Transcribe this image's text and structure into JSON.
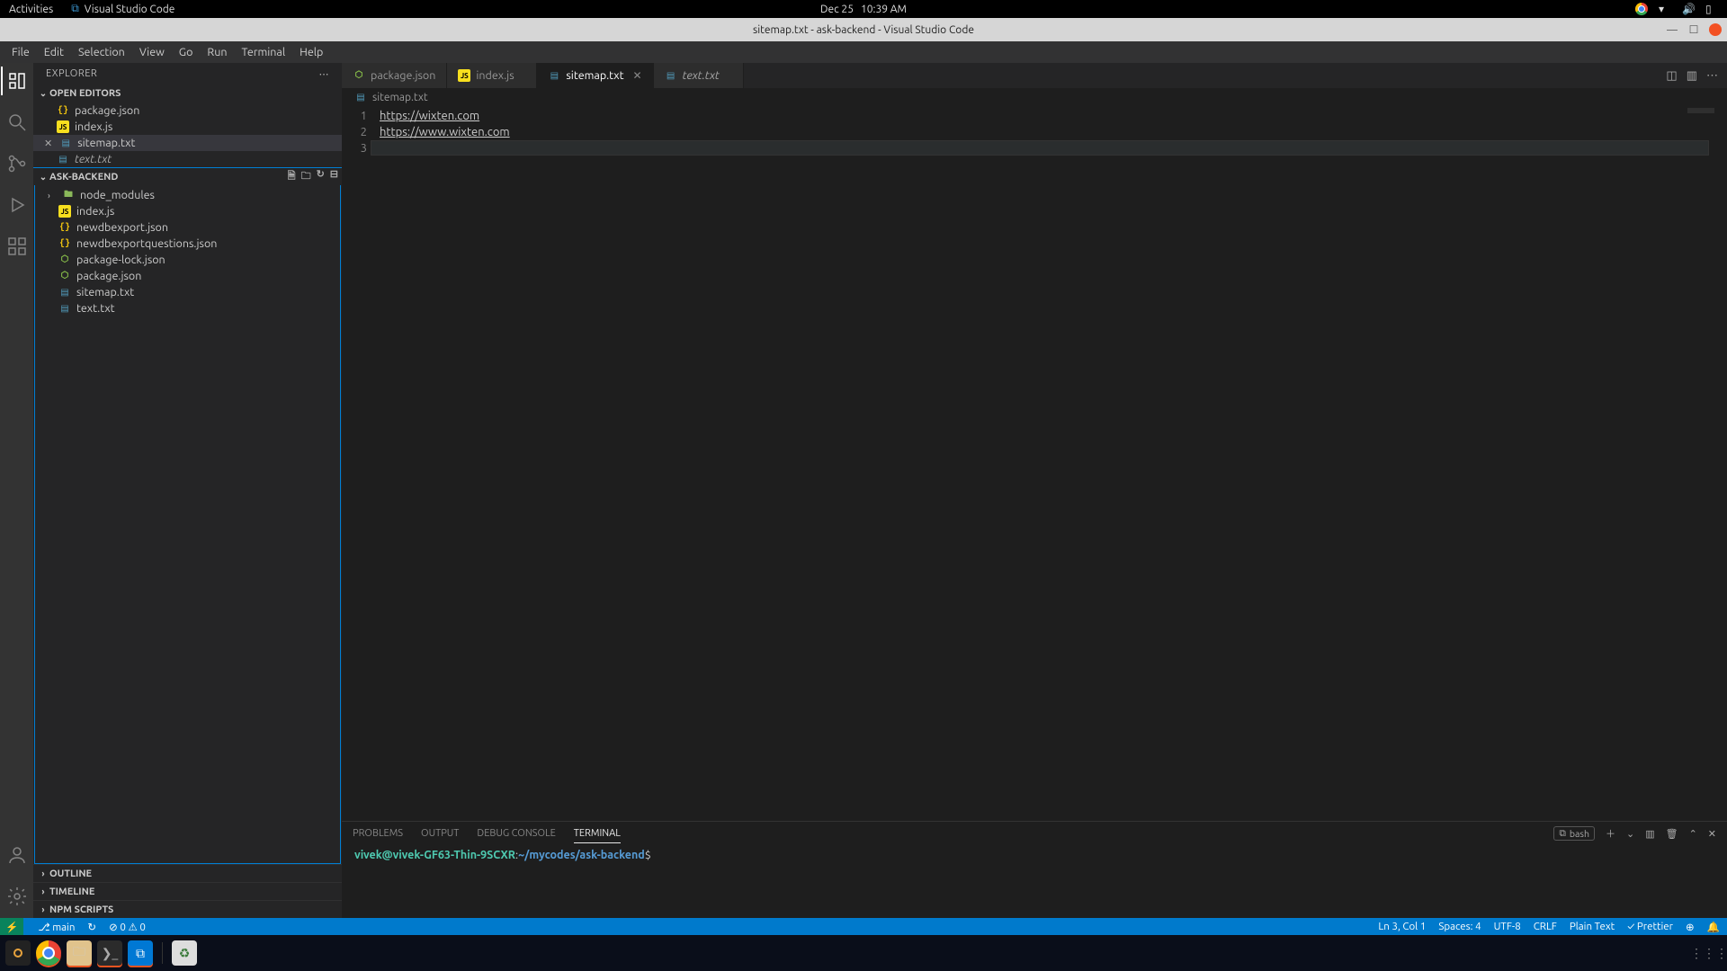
{
  "os": {
    "activities": "Activities",
    "app_label": "Visual Studio Code",
    "date": "Dec 25",
    "time": "10:39 AM"
  },
  "window": {
    "title": "sitemap.txt - ask-backend - Visual Studio Code"
  },
  "menu": [
    "File",
    "Edit",
    "Selection",
    "View",
    "Go",
    "Run",
    "Terminal",
    "Help"
  ],
  "sidebar": {
    "title": "EXPLORER",
    "open_editors_label": "OPEN EDITORS",
    "open_editors": [
      {
        "name": "package.json",
        "icon": "json"
      },
      {
        "name": "index.js",
        "icon": "js"
      },
      {
        "name": "sitemap.txt",
        "icon": "txt",
        "active": true
      },
      {
        "name": "text.txt",
        "icon": "txt",
        "italic": true
      }
    ],
    "project_label": "ASK-BACKEND",
    "tree": [
      {
        "name": "node_modules",
        "icon": "folder",
        "chev": true
      },
      {
        "name": "index.js",
        "icon": "js"
      },
      {
        "name": "newdbexport.json",
        "icon": "json"
      },
      {
        "name": "newdbexportquestions.json",
        "icon": "json"
      },
      {
        "name": "package-lock.json",
        "icon": "json-npm"
      },
      {
        "name": "package.json",
        "icon": "json-npm"
      },
      {
        "name": "sitemap.txt",
        "icon": "txt"
      },
      {
        "name": "text.txt",
        "icon": "txt"
      }
    ],
    "outline_label": "OUTLINE",
    "timeline_label": "TIMELINE",
    "npm_label": "NPM SCRIPTS"
  },
  "tabs": [
    {
      "label": "package.json",
      "icon": "json-npm"
    },
    {
      "label": "index.js",
      "icon": "js"
    },
    {
      "label": "sitemap.txt",
      "icon": "txt",
      "active": true,
      "closeable": true
    },
    {
      "label": "text.txt",
      "icon": "txt",
      "italic": true
    }
  ],
  "breadcrumb": {
    "file": "sitemap.txt"
  },
  "editor": {
    "lines": [
      "https://wixten.com",
      "https://www.wixten.com",
      ""
    ]
  },
  "panel": {
    "tabs": [
      "PROBLEMS",
      "OUTPUT",
      "DEBUG CONSOLE",
      "TERMINAL"
    ],
    "active": "TERMINAL",
    "shell_label": "bash",
    "prompt_user": "vivek@vivek-GF63-Thin-9SCXR",
    "prompt_path": "~/mycodes/ask-backend"
  },
  "status": {
    "branch": "main",
    "sync": "↻",
    "errors": "0",
    "warnings": "0",
    "ln_col": "Ln 3, Col 1",
    "spaces": "Spaces: 4",
    "encoding": "UTF-8",
    "eol": "CRLF",
    "lang": "Plain Text",
    "prettier": "Prettier"
  }
}
